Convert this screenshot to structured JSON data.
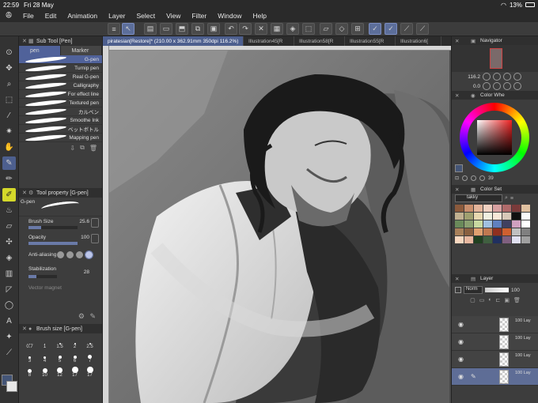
{
  "status": {
    "time": "22:59",
    "date": "Fri 28 May",
    "battery": "13%"
  },
  "menu": [
    "File",
    "Edit",
    "Animation",
    "Layer",
    "Select",
    "View",
    "Filter",
    "Window",
    "Help"
  ],
  "doc_tabs": [
    "piratesian[Restore]* (210.00 x 362.91mm 350dpi 116.2%)",
    "Illustration45[R",
    "Illustration58[R",
    "Illustration55[R",
    "Illustration6["
  ],
  "subtool": {
    "title": "Sub Tool [Pen]",
    "tabs": [
      "pen",
      "Marker"
    ],
    "brushes": [
      "G-pen",
      "Turnip pen",
      "Real G-pen",
      "Calligraphy",
      "For effect line",
      "Textured pen",
      "カルベン",
      "Smoothe Ink",
      "ベットボトル",
      "Mapping pen"
    ]
  },
  "toolprop": {
    "title": "Tool property [G-pen]",
    "preview_label": "G-pen",
    "brush_size_label": "Brush Size",
    "brush_size": "25.6",
    "opacity_label": "Opacity",
    "opacity": "100",
    "aa_label": "Anti-aliasing",
    "stab_label": "Stabilization",
    "stab": "28",
    "vector_label": "Vector magnet"
  },
  "brushsize": {
    "title": "Brush size [G-pen]",
    "sizes": [
      "0.7",
      "1",
      "1.5",
      "2",
      "2.5",
      "3",
      "4",
      "5",
      "6",
      "7",
      "8",
      "10",
      "12",
      "17",
      "17"
    ]
  },
  "navigator": {
    "title": "Navigator",
    "zoom": "116.2",
    "angle": "0.0"
  },
  "colorwheel": {
    "title": "Color Whe",
    "values": "39"
  },
  "colorset": {
    "title": "Color Set",
    "set_name": "takky",
    "colors": [
      "#8b5a3c",
      "#c98f6d",
      "#e3b49a",
      "#f0d0c0",
      "#d8a0a0",
      "#b06a6a",
      "#7a3a3a",
      "#e0c0a0",
      "#c0b090",
      "#a0a070",
      "#e8d8b0",
      "#f0f0e0",
      "#f8e8d8",
      "#d8c8b8",
      "#101010",
      "#fafafa",
      "#6a8a5a",
      "#8aa070",
      "#c8d8a0",
      "#a0c0e0",
      "#6080c0",
      "#404060",
      "#d0a0c0",
      "#ffffff",
      "#a8805a",
      "#8a6040",
      "#e0a070",
      "#c07850",
      "#903020",
      "#d06030",
      "#c0c0c0",
      "#808080",
      "#f8d8c0",
      "#e8b8a0",
      "#204020",
      "#406040",
      "#203060",
      "#806080",
      "#e0e0f0",
      "#a0a0a0"
    ]
  },
  "layer": {
    "title": "Layer",
    "blend": "Norm",
    "opacity": "100",
    "rows": [
      {
        "label": "100 Lay"
      },
      {
        "label": "100 Lay"
      },
      {
        "label": "100 Lay"
      },
      {
        "label": "100 Lay"
      }
    ]
  },
  "colors": {
    "accent": "#4d5f8e",
    "panel": "#3d3d3d",
    "highlight": "#d4d82a"
  }
}
